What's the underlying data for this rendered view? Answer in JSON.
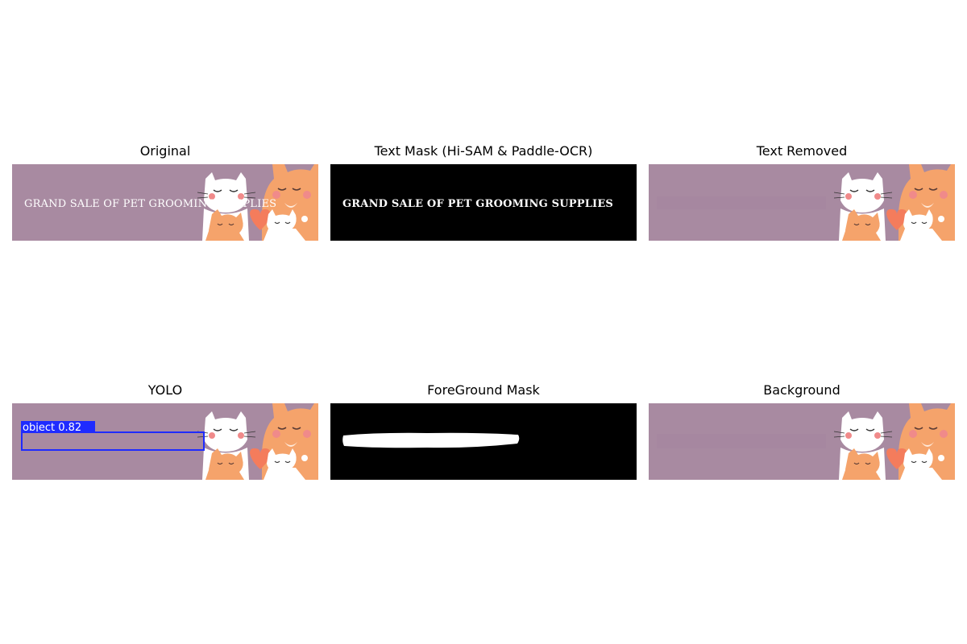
{
  "panels": {
    "original": {
      "title": "Original",
      "banner_text": "GRAND SALE OF PET GROOMING SUPPLIES"
    },
    "text_mask": {
      "title": "Text Mask (Hi-SAM & Paddle-OCR)",
      "banner_text": "GRAND SALE OF PET GROOMING SUPPLIES"
    },
    "text_removed": {
      "title": "Text Removed"
    },
    "yolo": {
      "title": "YOLO",
      "detection_label": "object  0.82"
    },
    "foreground_mask": {
      "title": "ForeGround Mask"
    },
    "background": {
      "title": "Background"
    }
  },
  "colors": {
    "banner_bg": "#a88aa1",
    "mask_bg": "#000000",
    "mask_fg": "#ffffff",
    "yolo_box": "#1f2bff",
    "cat_orange": "#f5a36b",
    "cat_white": "#ffffff",
    "cheek_pink": "#f08a8a",
    "heart": "#f47c5c"
  },
  "icons": {
    "cats_illustration": "cats-illustration-icon"
  }
}
